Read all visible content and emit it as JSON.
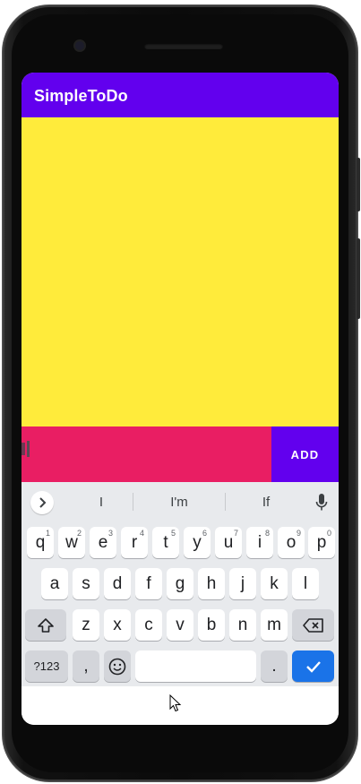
{
  "app": {
    "title": "SimpleToDo"
  },
  "input_row": {
    "value": "",
    "add_label": "ADD"
  },
  "keyboard": {
    "suggestions": [
      "I",
      "I'm",
      "If"
    ],
    "row1": [
      {
        "k": "q",
        "h": "1"
      },
      {
        "k": "w",
        "h": "2"
      },
      {
        "k": "e",
        "h": "3"
      },
      {
        "k": "r",
        "h": "4"
      },
      {
        "k": "t",
        "h": "5"
      },
      {
        "k": "y",
        "h": "6"
      },
      {
        "k": "u",
        "h": "7"
      },
      {
        "k": "i",
        "h": "8"
      },
      {
        "k": "o",
        "h": "9"
      },
      {
        "k": "p",
        "h": "0"
      }
    ],
    "row2": [
      "a",
      "s",
      "d",
      "f",
      "g",
      "h",
      "j",
      "k",
      "l"
    ],
    "row3": [
      "z",
      "x",
      "c",
      "v",
      "b",
      "n",
      "m"
    ],
    "symbols_label": "?123",
    "comma_label": ",",
    "period_label": ".",
    "icons": {
      "expand": "chevron-right-icon",
      "mic": "microphone-icon",
      "shift": "shift-icon",
      "backspace": "backspace-icon",
      "emoji": "emoji-icon",
      "enter": "checkmark-icon"
    }
  },
  "colors": {
    "appbar": "#6200ee",
    "list_background": "#ffeb3b",
    "input_background": "#e91e63",
    "add_button": "#6200ee",
    "keyboard_background": "#e8eaed",
    "enter_key": "#1a73e8"
  }
}
